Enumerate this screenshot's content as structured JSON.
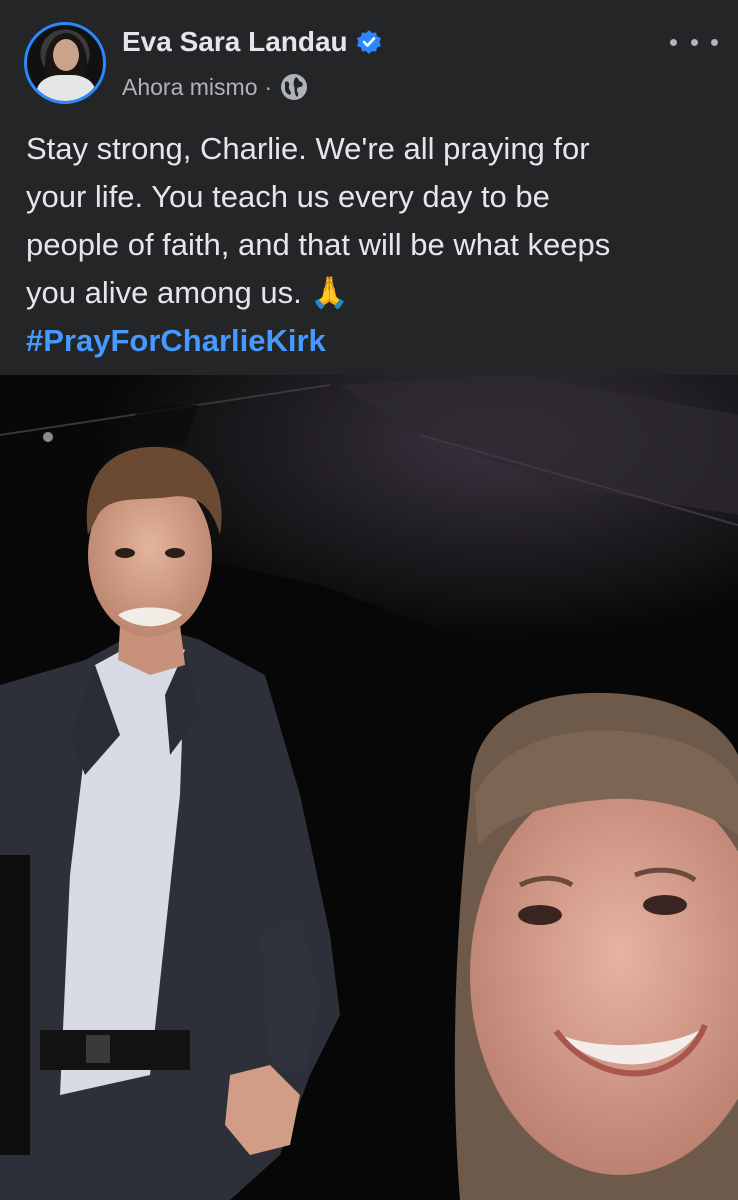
{
  "post": {
    "author": {
      "name": "Eva Sara Landau",
      "verified": true
    },
    "timestamp": "Ahora mismo",
    "separator": "·",
    "audience_icon": "globe-icon",
    "more_icon": "more-options-icon",
    "text_lines": [
      "Stay strong, Charlie. We're all praying for",
      "your life. You teach us every day to be",
      "people of faith, and that will be what keeps",
      "you alive among us."
    ],
    "emoji": "🙏",
    "hashtag": "#PrayForCharlieKirk",
    "photo_icon": "selfie-photo"
  },
  "colors": {
    "background": "#242526",
    "text": "#e4e6eb",
    "secondary_text": "#b0b3b8",
    "link": "#4599ff",
    "verified": "#2d88ff"
  }
}
